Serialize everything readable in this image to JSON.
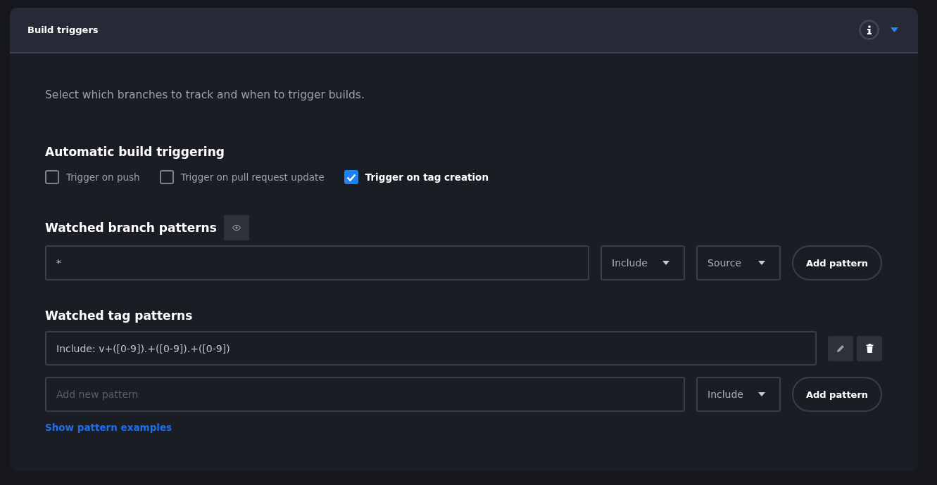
{
  "panel": {
    "title": "Build triggers",
    "expanded": true
  },
  "description": "Select which branches to track and when to trigger builds.",
  "automatic": {
    "heading": "Automatic build triggering",
    "options": [
      {
        "label": "Trigger on push",
        "checked": false
      },
      {
        "label": "Trigger on pull request update",
        "checked": false
      },
      {
        "label": "Trigger on tag creation",
        "checked": true
      }
    ]
  },
  "branch_patterns": {
    "heading": "Watched branch patterns",
    "pattern": "*",
    "mode": "Include",
    "source": "Source",
    "add_button": "Add pattern"
  },
  "tag_patterns": {
    "heading": "Watched tag patterns",
    "patterns": [
      "Include: v+([0-9]).+([0-9]).+([0-9])"
    ],
    "new_placeholder": "Add new pattern",
    "mode": "Include",
    "add_button": "Add pattern",
    "examples_link": "Show pattern examples"
  }
}
